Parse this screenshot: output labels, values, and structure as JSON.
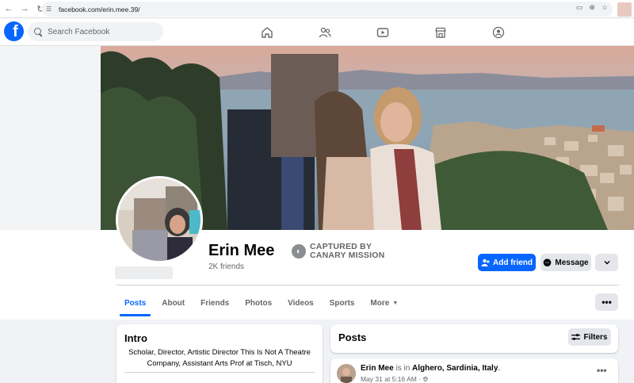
{
  "browser": {
    "url": "facebook.com/erin.mee.39/"
  },
  "header": {
    "search_placeholder": "Search Facebook"
  },
  "profile": {
    "name": "Erin Mee",
    "friends": "2K friends",
    "watermark_line1": "CAPTURED BY",
    "watermark_line2": "CANARY MISSION",
    "add_friend": "Add friend",
    "message": "Message"
  },
  "tabs": [
    "Posts",
    "About",
    "Friends",
    "Photos",
    "Videos",
    "Sports",
    "More"
  ],
  "intro": {
    "title": "Intro",
    "bio": "Scholar, Director, Artistic Director This Is Not A Theatre Company, Assistant Arts Prof at Tisch, NYU"
  },
  "posts": {
    "title": "Posts",
    "filters": "Filters",
    "item": {
      "author": "Erin Mee",
      "connector": " is in ",
      "place": "Alghero, Sardinia, Italy",
      "period": ".",
      "time": "May 31 at 5:16 AM · "
    }
  },
  "colors": {
    "brand": "#0866ff",
    "bg": "#f0f2f5"
  }
}
